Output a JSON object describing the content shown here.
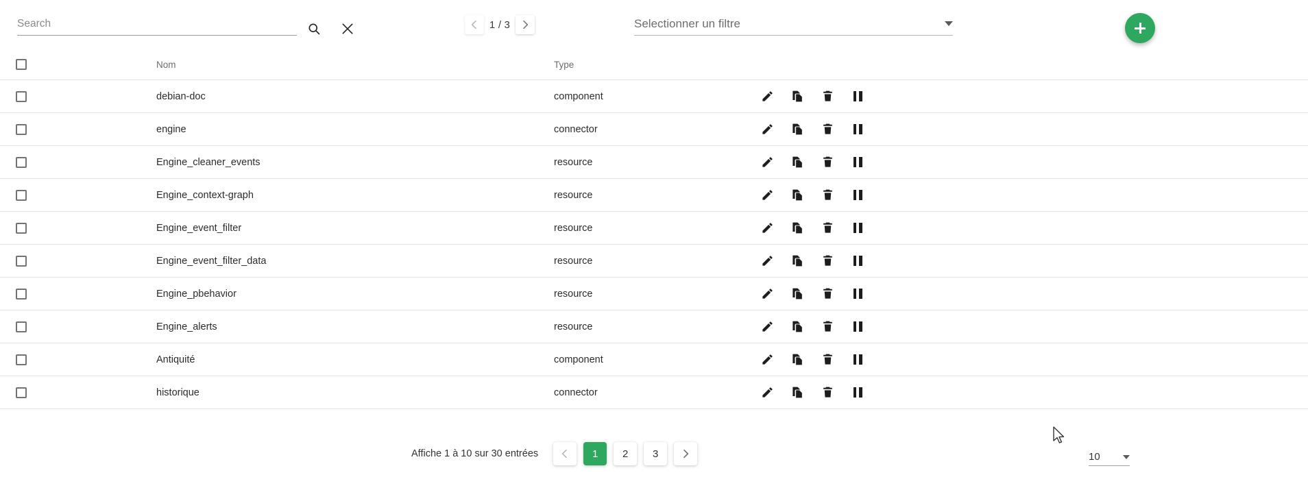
{
  "toolbar": {
    "search_placeholder": "Search",
    "search_value": "",
    "search_icon": "search-icon",
    "clear_icon": "close-icon",
    "page_indicator": "1 / 3",
    "prev_icon": "chevron-left-icon",
    "next_icon": "chevron-right-icon",
    "filter_placeholder": "Selectionner un filtre",
    "filter_caret_icon": "chevron-down-icon",
    "add_icon": "plus-icon",
    "accent_color": "#2ea75f"
  },
  "table": {
    "columns": [
      "",
      "Nom",
      "Type",
      ""
    ],
    "header": {
      "name": "Nom",
      "type": "Type"
    },
    "actions": [
      {
        "name": "edit-icon",
        "label": "edit"
      },
      {
        "name": "duplicate-icon",
        "label": "duplicate"
      },
      {
        "name": "delete-icon",
        "label": "delete"
      },
      {
        "name": "pause-icon",
        "label": "pause"
      }
    ],
    "rows": [
      {
        "name": "debian-doc",
        "type": "component"
      },
      {
        "name": "engine",
        "type": "connector"
      },
      {
        "name": "Engine_cleaner_events",
        "type": "resource"
      },
      {
        "name": "Engine_context-graph",
        "type": "resource"
      },
      {
        "name": "Engine_event_filter",
        "type": "resource"
      },
      {
        "name": "Engine_event_filter_data",
        "type": "resource"
      },
      {
        "name": "Engine_pbehavior",
        "type": "resource"
      },
      {
        "name": "Engine_alerts",
        "type": "resource"
      },
      {
        "name": "Antiquité",
        "type": "component"
      },
      {
        "name": "historique",
        "type": "connector"
      }
    ]
  },
  "footer": {
    "info": "Affiche 1 à 10 sur 30 entrées",
    "prev_icon": "chevron-left-icon",
    "next_icon": "chevron-right-icon",
    "pages": [
      "1",
      "2",
      "3"
    ],
    "active_page": "1",
    "per_page": "10",
    "per_page_caret_icon": "chevron-down-icon"
  }
}
